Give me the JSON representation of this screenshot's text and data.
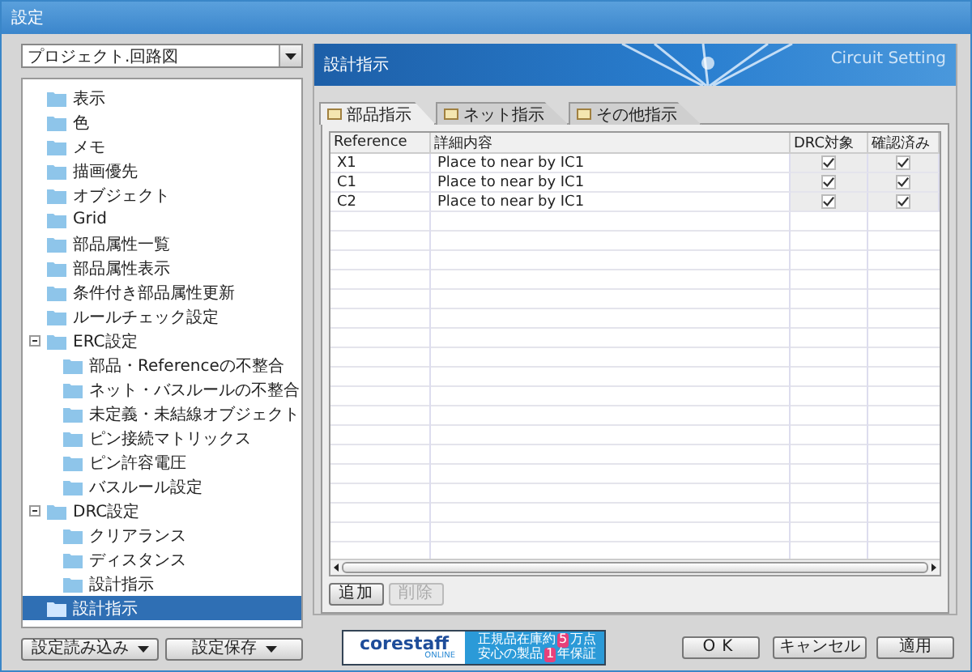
{
  "window": {
    "title": "設定"
  },
  "project_select": {
    "value": "プロジェクト.回路図"
  },
  "tree": [
    {
      "label": "表示",
      "selected": false
    },
    {
      "label": "色",
      "selected": false
    },
    {
      "label": "メモ",
      "selected": false
    },
    {
      "label": "描画優先",
      "selected": false
    },
    {
      "label": "オブジェクト",
      "selected": false
    },
    {
      "label": "Grid",
      "selected": false
    },
    {
      "label": "部品属性一覧",
      "selected": false
    },
    {
      "label": "部品属性表示",
      "selected": false
    },
    {
      "label": "条件付き部品属性更新",
      "selected": false
    },
    {
      "label": "ルールチェック設定",
      "selected": false
    },
    {
      "label": "ERC設定",
      "selected": false,
      "expanded": true,
      "children": [
        {
          "label": "部品・Referenceの不整合",
          "selected": false
        },
        {
          "label": "ネット・バスルールの不整合",
          "selected": false
        },
        {
          "label": "未定義・未結線オブジェクト",
          "selected": false
        },
        {
          "label": "ピン接続マトリックス",
          "selected": false
        },
        {
          "label": "ピン許容電圧",
          "selected": false
        },
        {
          "label": "バスルール設定",
          "selected": false
        }
      ]
    },
    {
      "label": "DRC設定",
      "selected": false,
      "expanded": true,
      "children": [
        {
          "label": "クリアランス",
          "selected": false
        },
        {
          "label": "ディスタンス",
          "selected": false
        },
        {
          "label": "設計指示",
          "selected": false
        }
      ]
    },
    {
      "label": "設計指示",
      "selected": true
    }
  ],
  "left_buttons": [
    "設定読み込み",
    "設定保存"
  ],
  "header": {
    "title": "設計指示",
    "subtitle": "Circuit Setting"
  },
  "tabs": [
    {
      "label": "部品指示",
      "selected": true
    },
    {
      "label": "ネット指示",
      "selected": false
    },
    {
      "label": "その他指示",
      "selected": false
    }
  ],
  "table": {
    "columns": [
      "Reference",
      "詳細内容",
      "DRC対象",
      "確認済み"
    ],
    "rows": [
      {
        "reference": "X1",
        "detail": "Place to near by IC1",
        "drc": true,
        "confirmed": true
      },
      {
        "reference": "C1",
        "detail": "Place to near by IC1",
        "drc": true,
        "confirmed": true
      },
      {
        "reference": "C2",
        "detail": "Place to near by IC1",
        "drc": true,
        "confirmed": true
      }
    ]
  },
  "table_buttons": [
    {
      "label": "追加",
      "disabled": false
    },
    {
      "label": "削除",
      "disabled": true
    }
  ],
  "ad": {
    "logo": "corestaff",
    "logo_sub": "ONLINE",
    "line1": [
      "正規品在庫約",
      "5",
      "万点"
    ],
    "line2": [
      "安心の製品",
      "1",
      "年保証"
    ]
  },
  "dialog_buttons": [
    "OK",
    "キャンセル",
    "適用"
  ]
}
